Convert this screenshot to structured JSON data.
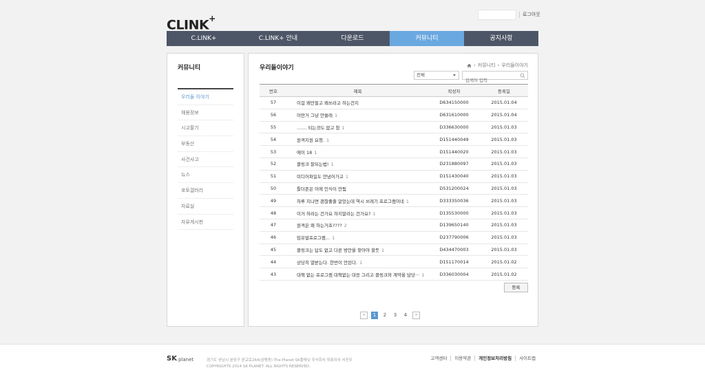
{
  "header": {
    "logo": "CLINK",
    "logo_plus": "+",
    "logout": "로그아웃",
    "nav": [
      "C.LINK+",
      "C.LINK+ 안내",
      "다운로드",
      "커뮤니티",
      "공지사항"
    ]
  },
  "sidebar": {
    "title": "커뮤니티",
    "items": [
      "우리들 이야기",
      "채용정보",
      "시고팔기",
      "부동산",
      "사건사고",
      "뉴스",
      "포토갤러리",
      "자료실",
      "자유게시판"
    ]
  },
  "content": {
    "title": "우리들이야기",
    "breadcrumb": [
      "커뮤니티",
      "우리들이야기"
    ],
    "filter_value": "전체",
    "search_placeholder": "검색어 입력",
    "columns": [
      "번호",
      "제목",
      "작성자",
      "등록일"
    ],
    "rows": [
      {
        "no": "57",
        "title": "이걸 왜만들고 왜쓰라고 하는건지",
        "count": "",
        "author": "D634150000",
        "date": "2015.01.04"
      },
      {
        "no": "56",
        "title": "이딴거 그냥 안쓸래",
        "count": "1",
        "author": "D631610000",
        "date": "2015.01.04"
      },
      {
        "no": "55",
        "title": "....... 되는것도 없고 참",
        "count": "1",
        "author": "D336630000",
        "date": "2015.01.03"
      },
      {
        "no": "54",
        "title": "원격지원 요청.",
        "count": "1",
        "author": "D151440049",
        "date": "2015.01.03"
      },
      {
        "no": "53",
        "title": "에이 18",
        "count": "1",
        "author": "D151440020",
        "date": "2015.01.03"
      },
      {
        "no": "52",
        "title": "클링크 잘되는법!",
        "count": "1",
        "author": "D231880097",
        "date": "2015.01.03"
      },
      {
        "no": "51",
        "title": "미디어파일도 안넘어가고",
        "count": "1",
        "author": "D151430040",
        "date": "2015.01.03"
      },
      {
        "no": "50",
        "title": "틀더폰은 이에 인식이 안됨",
        "count": "",
        "author": "D531200024",
        "date": "2015.01.03"
      },
      {
        "no": "49",
        "title": "하루 지나면 괜찮졸줄 알았는데 역시 쓰레기 프로그램이네",
        "count": "1",
        "author": "D333350036",
        "date": "2015.01.03"
      },
      {
        "no": "48",
        "title": "이거 하라는 건가요 하지말라는 건가요?",
        "count": "1",
        "author": "D135530000",
        "date": "2015.01.03"
      },
      {
        "no": "47",
        "title": "원격은 왜 하는거죠????",
        "count": "2",
        "author": "D139650140",
        "date": "2015.01.03"
      },
      {
        "no": "46",
        "title": "임유발프로그램...",
        "count": "1",
        "author": "D237790006",
        "date": "2015.01.03"
      },
      {
        "no": "45",
        "title": "클링크는 답도 없고 다른 방안을 찾아야 할듯",
        "count": "1",
        "author": "D434470003",
        "date": "2015.01.03"
      },
      {
        "no": "44",
        "title": "상당히 열받는다. 한번이 안된다.",
        "count": "1",
        "author": "D151170014",
        "date": "2015.01.02"
      },
      {
        "no": "43",
        "title": "대책 없는 프로그램 대책없는 대응 그리고 클링크와 계약을 담당···",
        "count": "1",
        "author": "D336030004",
        "date": "2015.01.02"
      }
    ],
    "register_button": "등록",
    "pager": {
      "prev": "«",
      "next": "»",
      "pages": [
        "1",
        "2",
        "3",
        "4"
      ],
      "current": "1"
    }
  },
  "footer": {
    "brand_sk": "SK",
    "brand_planet": "planet",
    "address": "경기도 성남시 분당구 판교로264(삼평동) The Planet SK플래닛 주식회사 대표이사 서진우",
    "copyright": "COPYRIGHTS 2014 SK PLANET. ALL RIGHTS RESERVED.",
    "links": [
      "고객센터",
      "이용약관",
      "개인정보처리방침",
      "사이트맵"
    ]
  }
}
